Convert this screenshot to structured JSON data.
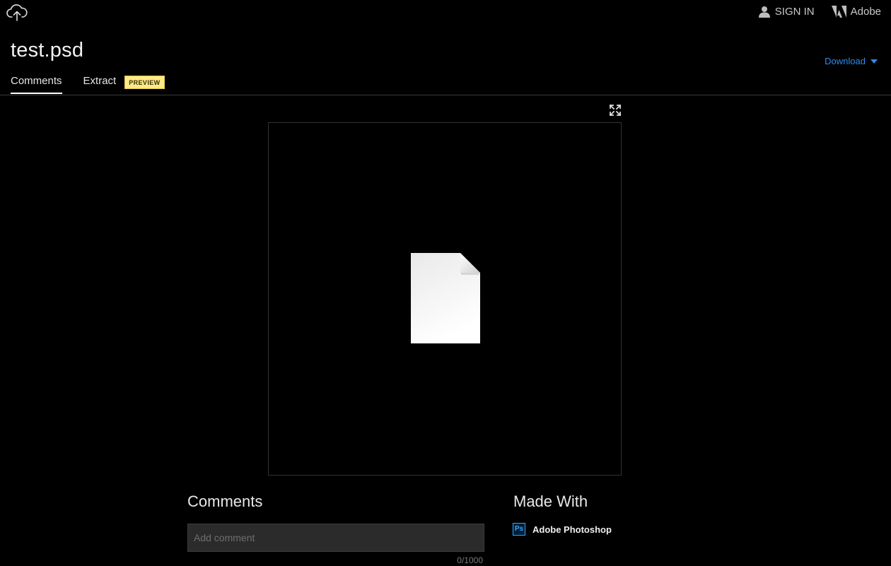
{
  "header": {
    "sign_in_label": "SIGN IN",
    "brand_label": "Adobe"
  },
  "file": {
    "title": "test.psd"
  },
  "download": {
    "label": "Download"
  },
  "tabs": [
    {
      "label": "Comments",
      "active": true
    },
    {
      "label": "Extract",
      "active": false,
      "badge": "PREVIEW"
    }
  ],
  "comments": {
    "heading": "Comments",
    "placeholder": "Add comment",
    "char_count": "0/1000"
  },
  "made_with": {
    "heading": "Made With",
    "app_icon_text": "Ps",
    "app_name": "Adobe Photoshop"
  },
  "colors": {
    "background": "#000000",
    "accent_blue": "#2d8ceb",
    "badge_yellow": "#fbe98a",
    "photoshop_blue": "#31a8ff"
  },
  "icons": {
    "cloud": "creative-cloud-upload-icon",
    "user": "user-icon",
    "adobe": "adobe-logo-icon",
    "dropdown": "caret-down-icon",
    "expand": "fullscreen-expand-icon",
    "document": "generic-document-icon"
  }
}
